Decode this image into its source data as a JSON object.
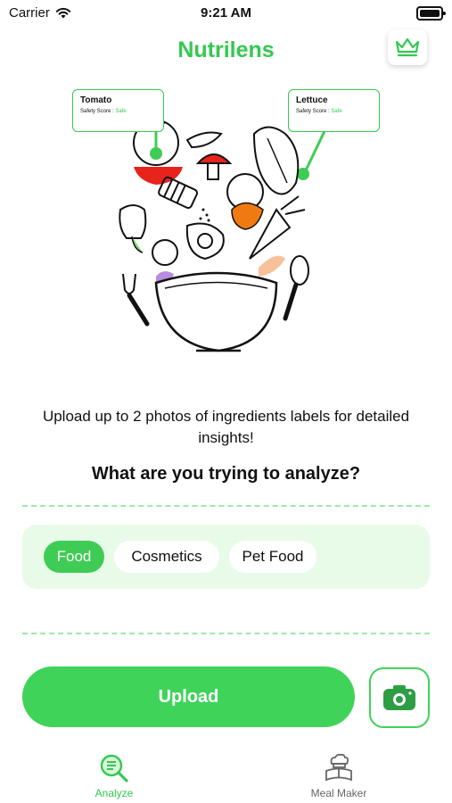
{
  "status": {
    "carrier": "Carrier",
    "time": "9:21 AM"
  },
  "header": {
    "title": "Nutrilens"
  },
  "illustration": {
    "tags": [
      {
        "name": "Tomato",
        "score_label": "Safety Score :",
        "score_value": "Safe"
      },
      {
        "name": "Lettuce",
        "score_label": "Safety Score :",
        "score_value": "Safe"
      }
    ]
  },
  "main": {
    "subtitle": "Upload up to 2 photos of ingredients labels for detailed insights!",
    "question": "What are you trying to analyze?",
    "categories": [
      {
        "label": "Food",
        "selected": true
      },
      {
        "label": "Cosmetics",
        "selected": false
      },
      {
        "label": "Pet Food",
        "selected": false
      }
    ],
    "upload_label": "Upload"
  },
  "tabs": [
    {
      "label": "Analyze",
      "active": true,
      "icon": "magnifier-document-icon"
    },
    {
      "label": "Meal Maker",
      "active": false,
      "icon": "book-chef-icon"
    }
  ],
  "colors": {
    "accent": "#35c84f",
    "panel": "#e8fbe9",
    "divider": "#9ee8ad"
  }
}
